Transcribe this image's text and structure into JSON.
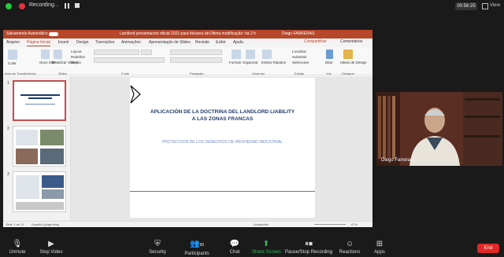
{
  "zoom_top": {
    "recording_label": "Recording...",
    "timer": "00:56:25",
    "view_label": "View"
  },
  "ppt": {
    "autosave_label": "Salvamento Automático",
    "doc_title": "Landlord presentacion oficial 2021 para folvares de",
    "modified": "Última modificação: há 2 h",
    "user": "Diego FARRERAS",
    "tabs": [
      "Arquivo",
      "Página Inicial",
      "Inserir",
      "Design",
      "Transições",
      "Animações",
      "Apresentação de Slides",
      "Revisão",
      "Exibir",
      "Ajuda"
    ],
    "share_label": "Compartilhar",
    "comments_label": "Comentários",
    "ribbon": {
      "paste": "Colar",
      "new_slide": "Novo Slide",
      "reuse": "Reutilizar Slides",
      "layout": "Layout",
      "reset": "Redefinir",
      "section": "Seção",
      "shapes": "Formas",
      "arrange": "Organizar",
      "quick_styles": "Estilos Rápidos",
      "find": "Localizar",
      "replace": "Substituir",
      "select": "Selecionar",
      "dictate": "Ditar",
      "design_ideas": "Ideias de Design",
      "groups": [
        "Área de Transferência",
        "Slides",
        "Fonte",
        "Parágrafo",
        "Desenho",
        "Edição",
        "Voz",
        "Designer"
      ]
    },
    "slide": {
      "title_line1": "APLICACIÓN DE LA DOCTRINA DEL LANDLORD LIABILITY",
      "title_line2": "A LAS ZONAS FRANCAS",
      "subtitle": "PROTECCION DE LOS DERECHOS DE PROPIEDAD INDUSTRIAL"
    },
    "thumb_numbers": [
      "1",
      "2",
      "3"
    ],
    "status": {
      "slide_count": "Slide 1 de 13",
      "language": "Español (Argentina)",
      "notes": "Anotações",
      "zoom": "67%"
    }
  },
  "video": {
    "participant_name": "Diego Farreras"
  },
  "toolbar": {
    "unmute": "Unmute",
    "stop_video": "Stop Video",
    "security": "Security",
    "participants": "Participants",
    "participants_count": "88",
    "chat": "Chat",
    "share_screen": "Share Screen",
    "pause_stop": "Pause/Stop Recording",
    "reactions": "Reactions",
    "apps": "Apps",
    "end": "End"
  }
}
